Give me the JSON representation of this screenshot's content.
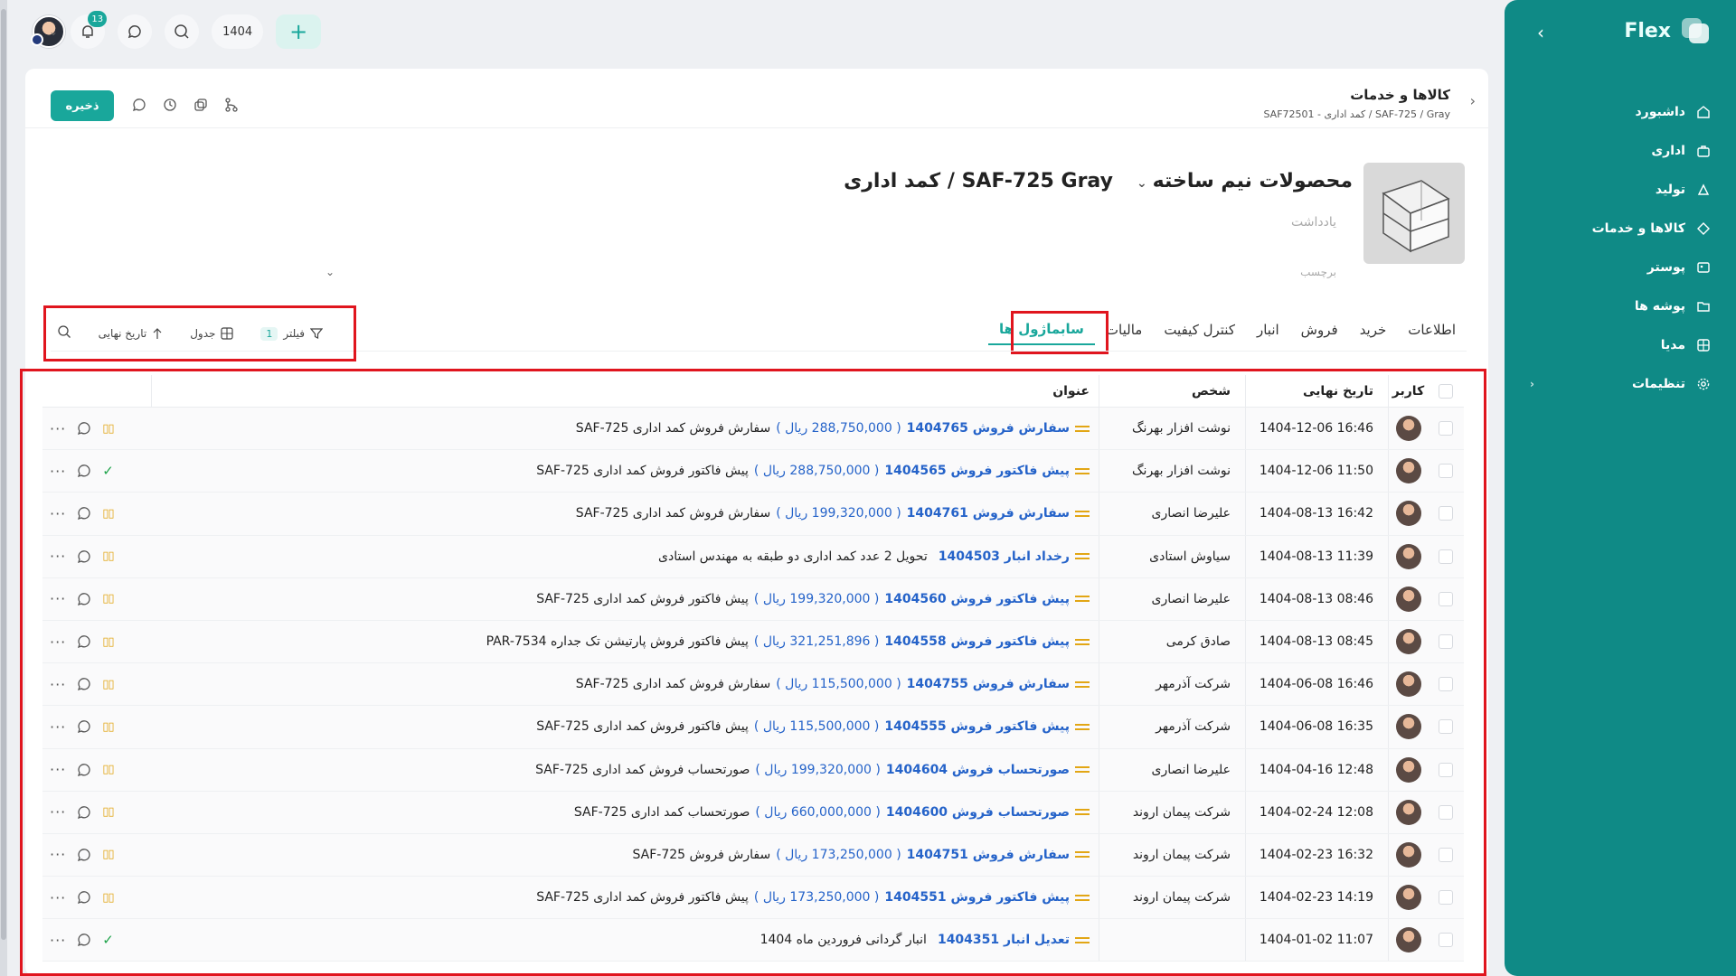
{
  "sidebar": {
    "brand": "Flex",
    "items": [
      {
        "label": "داشبورد",
        "icon": "home-icon"
      },
      {
        "label": "اداری",
        "icon": "briefcase-icon"
      },
      {
        "label": "تولید",
        "icon": "factory-icon"
      },
      {
        "label": "کالاها و خدمات",
        "icon": "products-icon"
      },
      {
        "label": "پوستر",
        "icon": "poster-icon"
      },
      {
        "label": "پوشه ها",
        "icon": "folder-icon"
      },
      {
        "label": "مدیا",
        "icon": "media-icon"
      },
      {
        "label": "تنظیمات",
        "icon": "gear-icon"
      }
    ]
  },
  "topbar": {
    "notifications": "13",
    "year": "1404"
  },
  "header": {
    "save": "ذخیره",
    "breadcrumb_title": "کالاها و خدمات",
    "breadcrumb_sub": "SAF72501 - کمد اداری / SAF-725 / Gray"
  },
  "product": {
    "category": "محصولات نیم ساخته",
    "name": "کمد اداری / SAF-725 Gray",
    "note_placeholder": "یادداشت",
    "tag_placeholder": "برچسب"
  },
  "tabs": [
    "اطلاعات",
    "خرید",
    "فروش",
    "انبار",
    "کنترل کیفیت",
    "مالیات",
    "سابماژول ها"
  ],
  "toolbar": {
    "filter": "فیلتر",
    "filter_count": "1",
    "view": "جدول",
    "sort": "تاریخ نهایی"
  },
  "table": {
    "headers": {
      "user": "کاربر",
      "date": "تاریخ نهایی",
      "person": "شخص",
      "title": "عنوان"
    },
    "rows": [
      {
        "date": "1404-12-06 16:46",
        "person": "نوشت افزار بهرنگ",
        "link": "سفارش فروش 1404765",
        "amount": "( 288,750,000 ریال )",
        "desc": "سفارش فروش کمد اداری SAF-725",
        "status": "pause"
      },
      {
        "date": "1404-12-06 11:50",
        "person": "نوشت افزار بهرنگ",
        "link": "پیش فاکتور فروش 1404565",
        "amount": "( 288,750,000 ریال )",
        "desc": "پیش فاکتور فروش کمد اداری SAF-725",
        "status": "done"
      },
      {
        "date": "1404-08-13 16:42",
        "person": "علیرضا انصاری",
        "link": "سفارش فروش 1404761",
        "amount": "( 199,320,000 ریال )",
        "desc": "سفارش فروش کمد اداری SAF-725",
        "status": "pause"
      },
      {
        "date": "1404-08-13 11:39",
        "person": "سیاوش استادی",
        "link": "رخداد انبار 1404503",
        "amount": "",
        "desc": "تحویل 2 عدد کمد اداری دو طبقه به مهندس استادی",
        "status": "pause"
      },
      {
        "date": "1404-08-13 08:46",
        "person": "علیرضا انصاری",
        "link": "پیش فاکتور فروش 1404560",
        "amount": "( 199,320,000 ریال )",
        "desc": "پیش فاکتور فروش کمد اداری SAF-725",
        "status": "pause"
      },
      {
        "date": "1404-08-13 08:45",
        "person": "صادق کرمی",
        "link": "پیش فاکتور فروش 1404558",
        "amount": "( 321,251,896 ریال )",
        "desc": "پیش فاکتور فروش پارتیشن تک جداره PAR-7534",
        "status": "pause"
      },
      {
        "date": "1404-06-08 16:46",
        "person": "شرکت آذرمهر",
        "link": "سفارش فروش 1404755",
        "amount": "( 115,500,000 ریال )",
        "desc": "سفارش فروش کمد اداری SAF-725",
        "status": "pause"
      },
      {
        "date": "1404-06-08 16:35",
        "person": "شرکت آذرمهر",
        "link": "پیش فاکتور فروش 1404555",
        "amount": "( 115,500,000 ریال )",
        "desc": "پیش فاکتور فروش کمد اداری SAF-725",
        "status": "pause"
      },
      {
        "date": "1404-04-16 12:48",
        "person": "علیرضا انصاری",
        "link": "صورتحساب فروش 1404604",
        "amount": "( 199,320,000 ریال )",
        "desc": "صورتحساب فروش کمد اداری SAF-725",
        "status": "pause"
      },
      {
        "date": "1404-02-24 12:08",
        "person": "شرکت پیمان اروند",
        "link": "صورتحساب فروش 1404600",
        "amount": "( 660,000,000 ریال )",
        "desc": "صورتحساب کمد اداری SAF-725",
        "status": "pause"
      },
      {
        "date": "1404-02-23 16:32",
        "person": "شرکت پیمان اروند",
        "link": "سفارش فروش 1404751",
        "amount": "( 173,250,000 ریال )",
        "desc": "سفارش فروش SAF-725",
        "status": "pause"
      },
      {
        "date": "1404-02-23 14:19",
        "person": "شرکت پیمان اروند",
        "link": "پیش فاکتور فروش 1404551",
        "amount": "( 173,250,000 ریال )",
        "desc": "پیش فاکتور فروش کمد اداری SAF-725",
        "status": "pause"
      },
      {
        "date": "1404-01-02 11:07",
        "person": "",
        "link": "تعدیل انبار 1404351",
        "amount": "",
        "desc": "انبار گردانی فروردین ماه 1404",
        "status": "done"
      }
    ]
  },
  "colors": {
    "accent": "#19a79b",
    "sidebar": "#0f8a86",
    "link": "#2563c9",
    "warning": "#e2a615",
    "highlight": "#e0151e"
  }
}
